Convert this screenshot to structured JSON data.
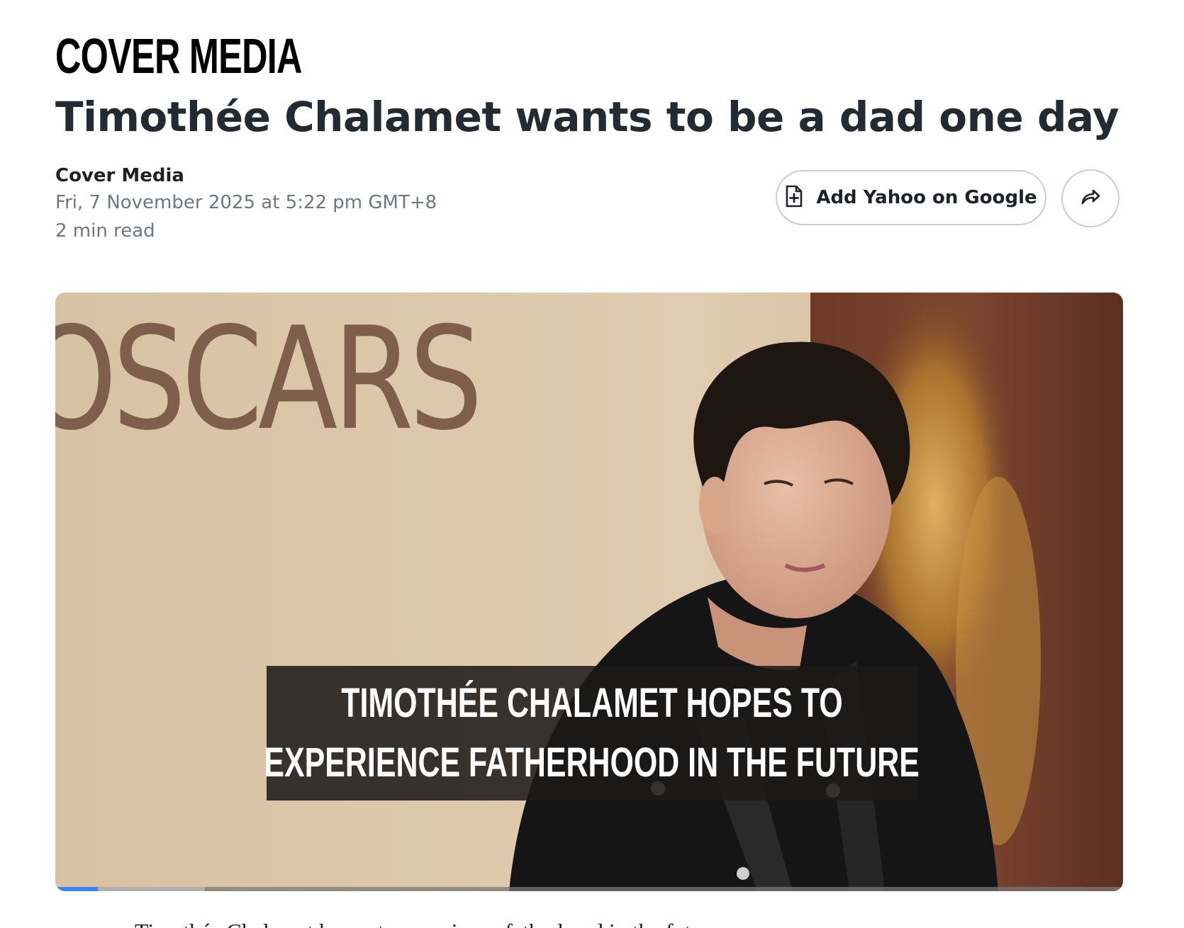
{
  "brand": {
    "logo_text": "COVER MEDIA"
  },
  "article": {
    "title": "Timothée Chalamet wants to be a dad one day",
    "author": "Cover Media",
    "published": "Fri, 7 November 2025 at 5:22 pm GMT+8",
    "read_time": "2 min read",
    "body_first_line": "Timothée Chalamet hopes to experience fatherhood in the future."
  },
  "actions": {
    "add_google_label": "Add Yahoo on Google",
    "add_google_icon": "document-plus-icon",
    "share_icon": "share-arrow-icon"
  },
  "video": {
    "background_sign_text": "OSCARS",
    "caption_line_1": "TIMOTHÉE CHALAMET HOPES TO",
    "caption_line_2": "EXPERIENCE FATHERHOOD IN THE FUTURE",
    "progress_fraction": 0.04,
    "buffered_fraction": 0.14,
    "progress_color": "#3b82f6"
  },
  "colors": {
    "text_primary": "#1d2228",
    "text_secondary": "#6e7780",
    "button_border": "#c7cdd2"
  }
}
